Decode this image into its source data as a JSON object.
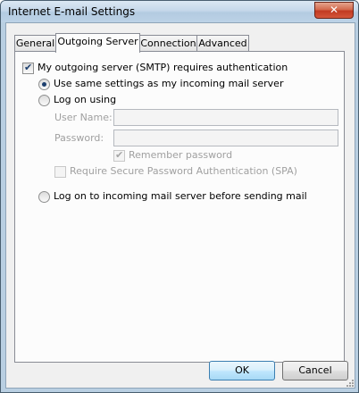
{
  "window": {
    "title": "Internet E-mail Settings",
    "close_glyph": "✕"
  },
  "tabs": [
    {
      "label": "General"
    },
    {
      "label": "Outgoing Server"
    },
    {
      "label": "Connection"
    },
    {
      "label": "Advanced"
    }
  ],
  "panel": {
    "smtp_auth": {
      "label": "My outgoing server (SMTP) requires authentication",
      "checked": true
    },
    "use_same": {
      "label": "Use same settings as my incoming mail server",
      "selected": true
    },
    "log_on_using": {
      "label": "Log on using",
      "selected": false
    },
    "user_name": {
      "label": "User Name:",
      "value": ""
    },
    "password": {
      "label": "Password:",
      "value": ""
    },
    "remember_password": {
      "label": "Remember password",
      "checked": true
    },
    "spa": {
      "label": "Require Secure Password Authentication (SPA)",
      "checked": false
    },
    "log_on_incoming": {
      "label": "Log on to incoming mail server before sending mail",
      "selected": false
    }
  },
  "buttons": {
    "ok": "OK",
    "cancel": "Cancel"
  },
  "check_glyph": "✔",
  "icons": {
    "close": "close-icon",
    "check": "checkmark-icon",
    "grip": "resize-grip-icon"
  }
}
